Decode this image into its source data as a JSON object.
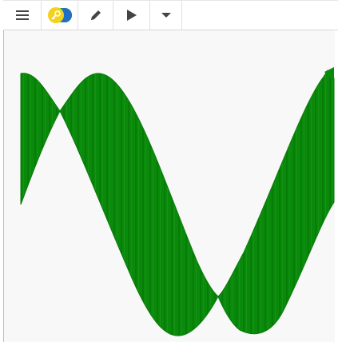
{
  "toolbar": {
    "menu_icon": "hamburger-menu-icon",
    "mode_icon": "key-toggle-icon",
    "edit_icon": "pencil-icon",
    "run_icon": "play-icon",
    "more_icon": "caret-down-icon"
  },
  "colors": {
    "ribbon_fill": "#0a8a0a",
    "ribbon_dark": "#067006",
    "canvas_bg": "#f8f8f8",
    "toggle_yellow": "#f3d21f",
    "toggle_blue": "#1f6fc4",
    "toggle_green": "#17b04c",
    "icon_gray": "#444444"
  }
}
